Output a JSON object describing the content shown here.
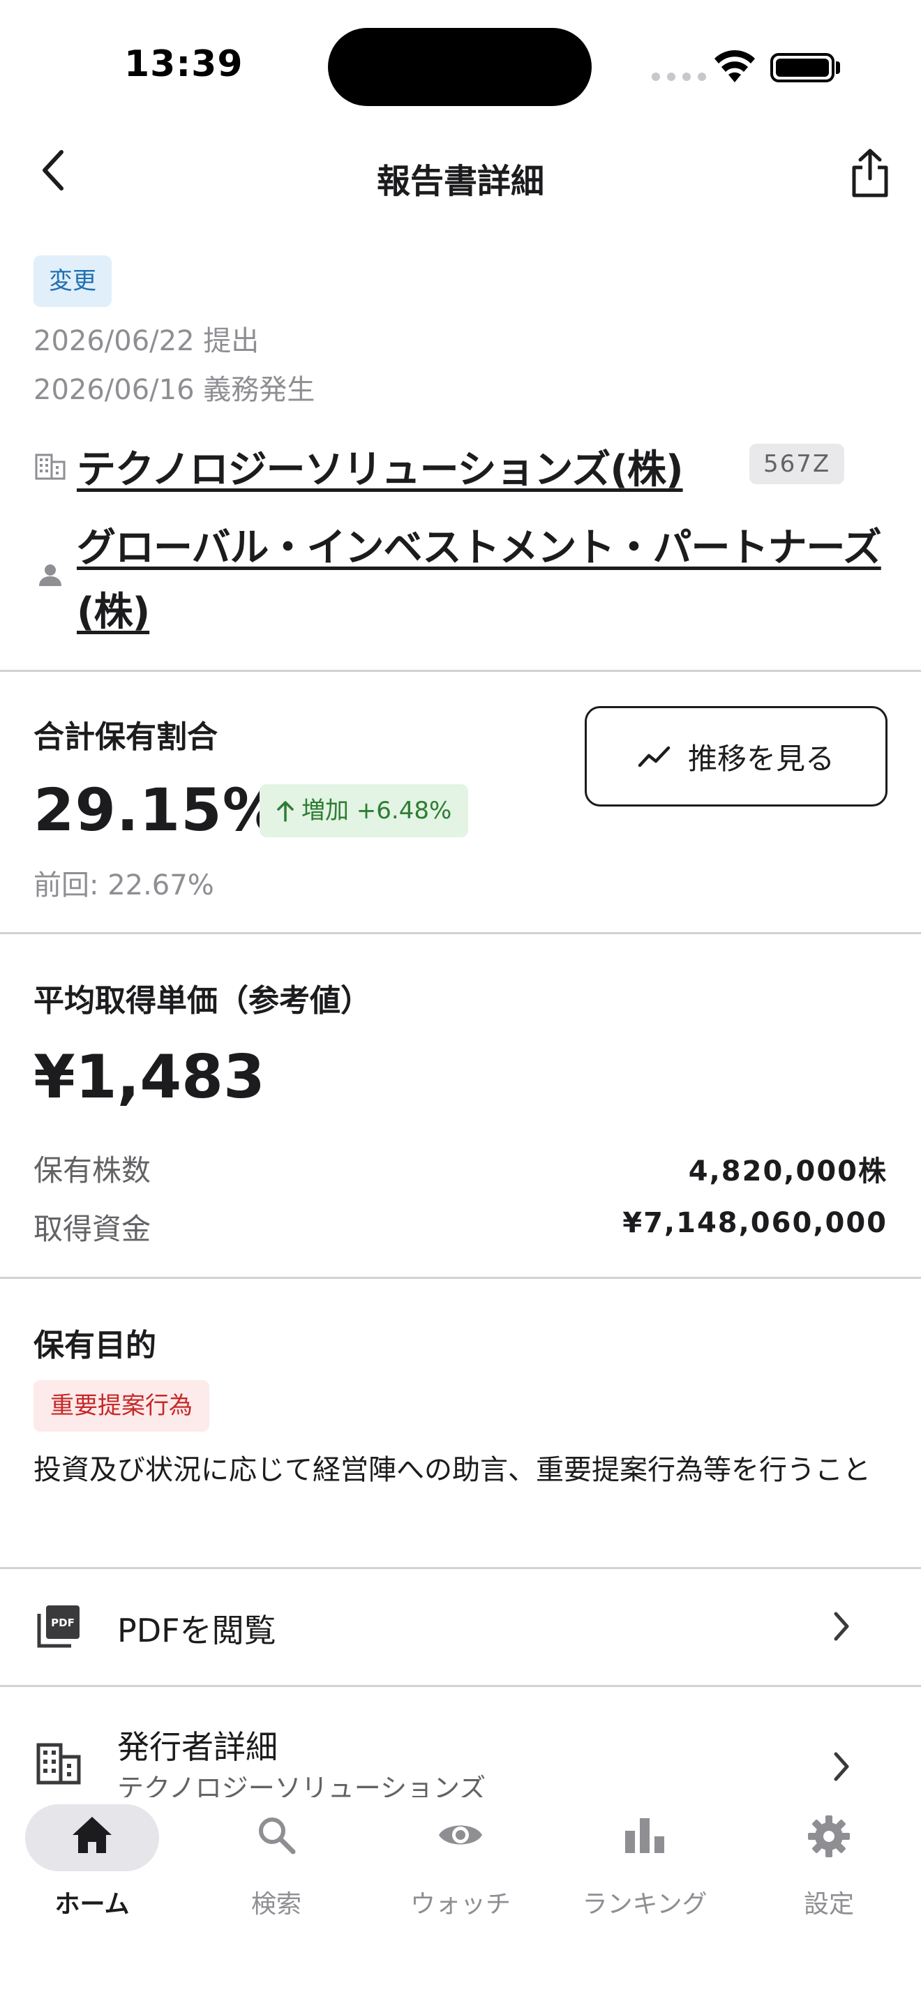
{
  "status_bar": {
    "time": "13:39"
  },
  "nav": {
    "title": "報告書詳細"
  },
  "report": {
    "type_badge": "変更",
    "submitted": "2026/06/22 提出",
    "obligation": "2026/06/16 義務発生",
    "issuer_name": "テクノロジーソリューションズ(株)",
    "issuer_code": "567Z",
    "holder_name": "グローバル・インベストメント・パートナーズ(株)"
  },
  "ratio": {
    "label": "合計保有割合",
    "value": "29.15%",
    "change_badge": "増加 +6.48%",
    "previous": "前回: 22.67%",
    "trend_button": "推移を見る"
  },
  "avg_price": {
    "label": "平均取得単価（参考値）",
    "value": "¥1,483",
    "shares_label": "保有株数",
    "shares_value": "4,820,000株",
    "funds_label": "取得資金",
    "funds_value": "¥7,148,060,000"
  },
  "purpose": {
    "label": "保有目的",
    "badge": "重要提案行為",
    "text": "投資及び状況に応じて経営陣への助言、重要提案行為等を行うこと"
  },
  "rows": {
    "pdf_title": "PDFを閲覧",
    "issuer_title": "発行者詳細",
    "issuer_sub": "テクノロジーソリューションズ"
  },
  "tabs": [
    {
      "label": "ホーム"
    },
    {
      "label": "検索"
    },
    {
      "label": "ウォッチ"
    },
    {
      "label": "ランキング"
    },
    {
      "label": "設定"
    }
  ],
  "colors": {
    "accent_blue": "#1f6fb2",
    "increase_green": "#2e7d32",
    "purpose_red": "#c62828",
    "text_primary": "#1c1c1e",
    "text_secondary": "#8e8e93"
  }
}
